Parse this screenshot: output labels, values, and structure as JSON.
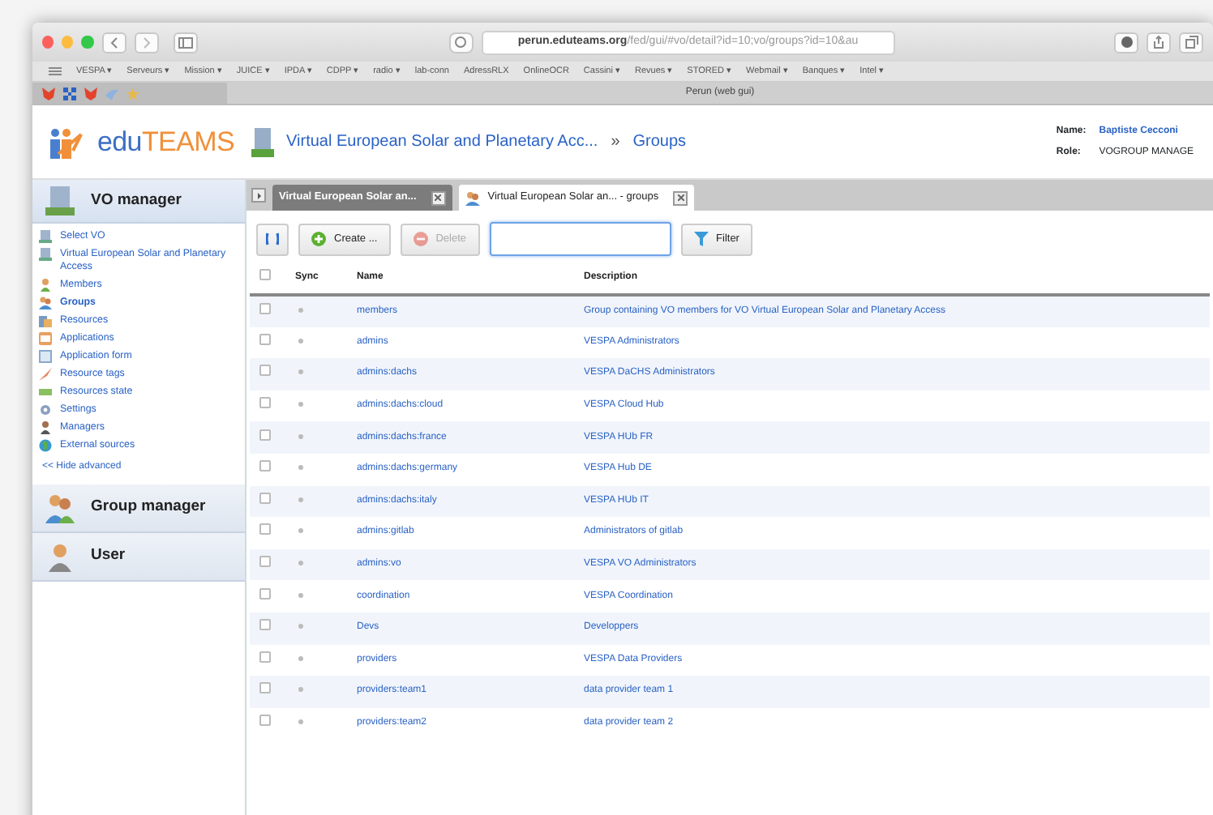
{
  "browser": {
    "url_host": "perun.eduteams.org",
    "url_path": "/fed/gui/#vo/detail?id=10;vo/groups?id=10&au",
    "bookmarks": [
      "VESPA ▾",
      "Serveurs ▾",
      "Mission ▾",
      "JUICE ▾",
      "IPDA ▾",
      "CDPP ▾",
      "radio ▾",
      "lab-conn",
      "AdressRLX",
      "OnlineOCR",
      "Cassini ▾",
      "Revues ▾",
      "STORED ▾",
      "Webmail ▾",
      "Banques ▾",
      "Intel ▾"
    ],
    "tab_title": "Perun (web gui)"
  },
  "header": {
    "logo_prefix": "edu",
    "logo_suffix": "TEAMS",
    "breadcrumb_vo": "Virtual European Solar and Planetary Acc...",
    "breadcrumb_separator": "»",
    "breadcrumb_page": "Groups",
    "name_label": "Name:",
    "name": "Baptiste Cecconi",
    "role_label": "Role:",
    "role": "VOGROUP MANAGE"
  },
  "sidebar": {
    "sections": [
      {
        "title": "VO manager",
        "expanded": true,
        "items": [
          {
            "label": "Select VO",
            "selected": false
          },
          {
            "label": "Virtual European Solar and Planetary Access",
            "selected": false
          },
          {
            "label": "Members",
            "selected": false
          },
          {
            "label": "Groups",
            "selected": true
          },
          {
            "label": "Resources",
            "selected": false
          },
          {
            "label": "Applications",
            "selected": false
          },
          {
            "label": "Application form",
            "selected": false
          },
          {
            "label": "Resource tags",
            "selected": false
          },
          {
            "label": "Resources state",
            "selected": false
          },
          {
            "label": "Settings",
            "selected": false
          },
          {
            "label": "Managers",
            "selected": false
          },
          {
            "label": "External sources",
            "selected": false
          }
        ],
        "toggle": "<< Hide advanced"
      },
      {
        "title": "Group manager",
        "expanded": false
      },
      {
        "title": "User",
        "expanded": false
      }
    ]
  },
  "tabs": [
    {
      "label": "Virtual European Solar an...",
      "selected": false
    },
    {
      "label": "Virtual European Solar an... - groups",
      "selected": true
    }
  ],
  "toolbar": {
    "create": "Create ...",
    "delete": "Delete",
    "delete_disabled": true,
    "filter": "Filter"
  },
  "table": {
    "select_all_checked": false,
    "columns": [
      "Sync",
      "Name",
      "Description"
    ],
    "rows": [
      {
        "name": "members",
        "description": "Group containing VO members for VO Virtual European Solar and Planetary Access",
        "checked": false
      },
      {
        "name": "admins",
        "description": "VESPA Administrators",
        "checked": false
      },
      {
        "name": "admins:dachs",
        "description": "VESPA DaCHS Administrators",
        "checked": false
      },
      {
        "name": "admins:dachs:cloud",
        "description": "VESPA Cloud Hub",
        "checked": false
      },
      {
        "name": "admins:dachs:france",
        "description": "VESPA HUb FR",
        "checked": false
      },
      {
        "name": "admins:dachs:germany",
        "description": "VESPA Hub DE",
        "checked": false
      },
      {
        "name": "admins:dachs:italy",
        "description": "VESPA HUb IT",
        "checked": false
      },
      {
        "name": "admins:gitlab",
        "description": "Administrators of gitlab",
        "checked": false
      },
      {
        "name": "admins:vo",
        "description": "VESPA VO Administrators",
        "checked": false
      },
      {
        "name": "coordination",
        "description": "VESPA Coordination",
        "checked": false
      },
      {
        "name": "Devs",
        "description": "Developpers",
        "checked": false
      },
      {
        "name": "providers",
        "description": "VESPA Data Providers",
        "checked": false
      },
      {
        "name": "providers:team1",
        "description": "data provider team 1",
        "checked": false
      },
      {
        "name": "providers:team2",
        "description": "data provider team 2",
        "checked": false
      }
    ]
  }
}
